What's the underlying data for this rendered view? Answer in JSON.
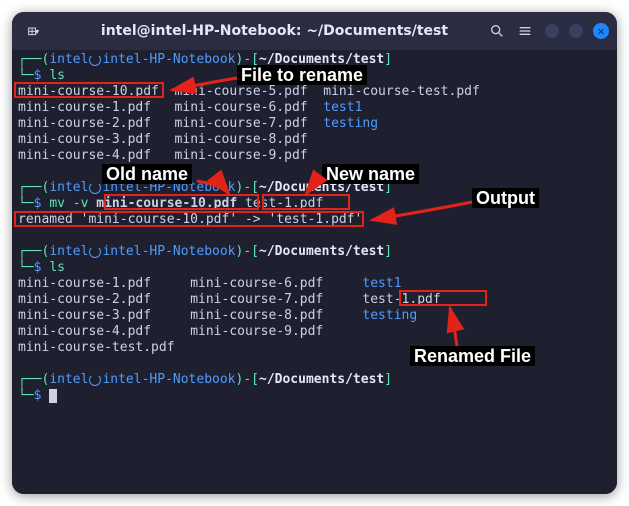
{
  "titlebar": {
    "title": "intel@intel-HP-Notebook: ~/Documents/test"
  },
  "prompt": {
    "user": "intel",
    "host": "intel-HP-Notebook",
    "path": "~/Documents/test",
    "dollar": "$"
  },
  "cmds": {
    "ls": "ls",
    "mv": "mv -v ",
    "mv_old": "mini-course-10.pdf",
    "mv_new": "test-1.pdf"
  },
  "ls1": {
    "r0c0": "mini-course-10.pdf",
    "r0c1": "mini-course-5.pdf",
    "r0c2": "mini-course-test.pdf",
    "r1c0": "mini-course-1.pdf",
    "r1c1": "mini-course-6.pdf",
    "r1c2": "test1",
    "r2c0": "mini-course-2.pdf",
    "r2c1": "mini-course-7.pdf",
    "r2c2": "testing",
    "r3c0": "mini-course-3.pdf",
    "r3c1": "mini-course-8.pdf",
    "r4c0": "mini-course-4.pdf",
    "r4c1": "mini-course-9.pdf"
  },
  "mv_output": "renamed 'mini-course-10.pdf' -> 'test-1.pdf'",
  "ls2": {
    "r0c0": "mini-course-1.pdf",
    "r0c1": "mini-course-6.pdf",
    "r0c2": "test1",
    "r1c0": "mini-course-2.pdf",
    "r1c1": "mini-course-7.pdf",
    "r1c2": "test-1.pdf",
    "r2c0": "mini-course-3.pdf",
    "r2c1": "mini-course-8.pdf",
    "r2c2": "testing",
    "r3c0": "mini-course-4.pdf",
    "r3c1": "mini-course-9.pdf",
    "r4c0": "mini-course-test.pdf"
  },
  "annotations": {
    "file_to_rename": "File to rename",
    "old_name": "Old name",
    "new_name": "New name",
    "output": "Output",
    "renamed_file": "Renamed File"
  }
}
